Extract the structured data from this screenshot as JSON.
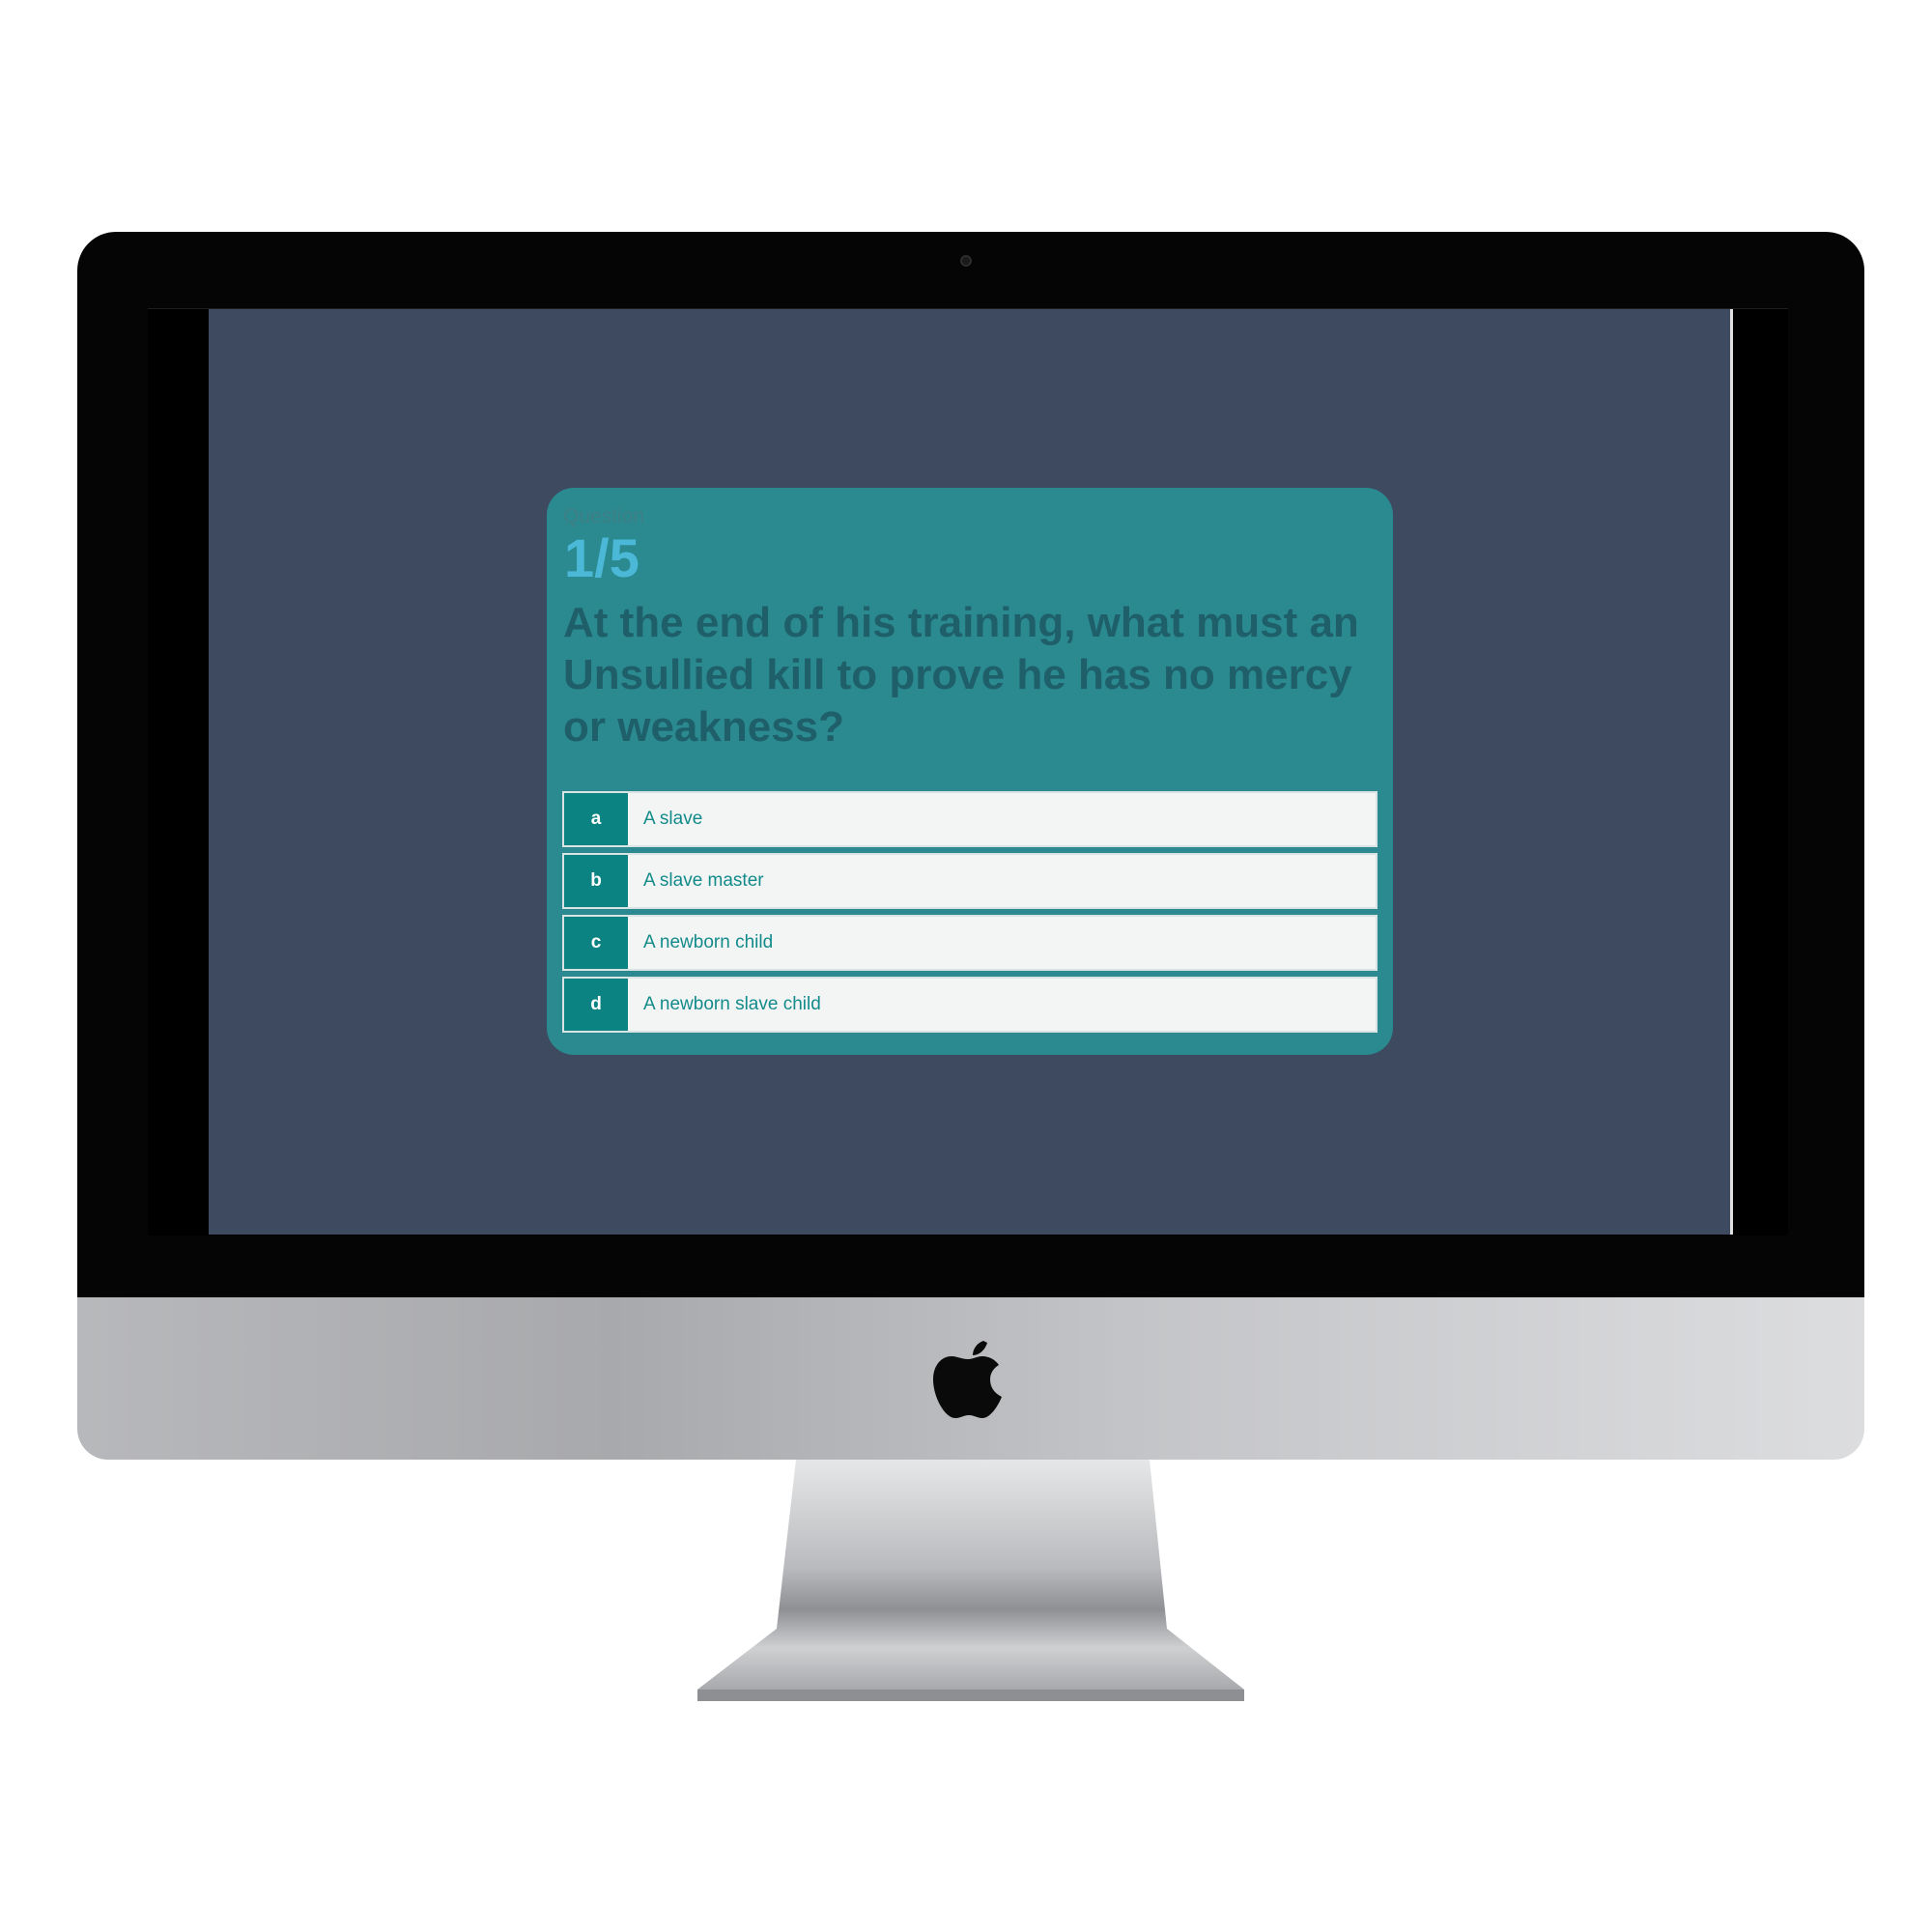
{
  "quiz": {
    "question_label": "Question",
    "counter": "1/5",
    "question_text": "At the end of his training, what must an Unsullied kill to prove he has no mercy or weakness?",
    "answers": [
      {
        "key": "a",
        "text": "A slave"
      },
      {
        "key": "b",
        "text": "A slave master"
      },
      {
        "key": "c",
        "text": "A newborn child"
      },
      {
        "key": "d",
        "text": "A newborn slave child"
      }
    ]
  },
  "colors": {
    "screen_background": "#3e4a60",
    "card_background": "#2b8a90",
    "counter": "#4ab8d6",
    "question_text": "#1e5f6a",
    "answer_key_background": "#0b8383",
    "answer_text": "#138b8b"
  },
  "icons": {
    "brand_logo": "apple-logo-icon",
    "camera": "camera-icon"
  }
}
